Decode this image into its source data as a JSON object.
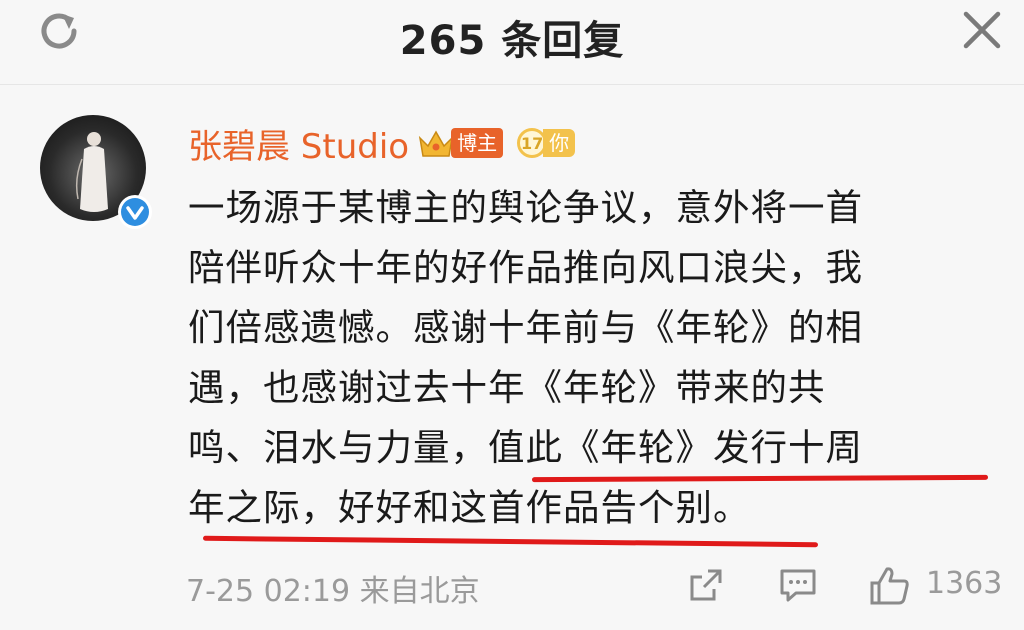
{
  "header": {
    "title": "265 条回复"
  },
  "post": {
    "author": "张碧晨 Studio",
    "badge_label": "博主",
    "level_number": "17",
    "level_text": "你",
    "lines": [
      "一场源于某博主的舆论争议，意外将一首",
      "陪伴听众十年的好作品推向风口浪尖，我",
      "们倍感遗憾。感谢十年前与《年轮》的相",
      "遇，也感谢过去十年《年轮》带来的共",
      "鸣、泪水与力量，值此《年轮》发行十周",
      "年之际，好好和这首作品告个别。"
    ],
    "timestamp": "7-25 02:19 来自北京",
    "like_count": "1363"
  },
  "icons": {
    "refresh": "refresh-icon",
    "close": "close-icon",
    "share": "share-icon",
    "comment": "comment-icon",
    "like": "like-icon"
  },
  "colors": {
    "author_name": "#e8632a",
    "underline": "#e01a1a",
    "verified": "#2e8ee0",
    "muted": "#9a9a9a"
  }
}
